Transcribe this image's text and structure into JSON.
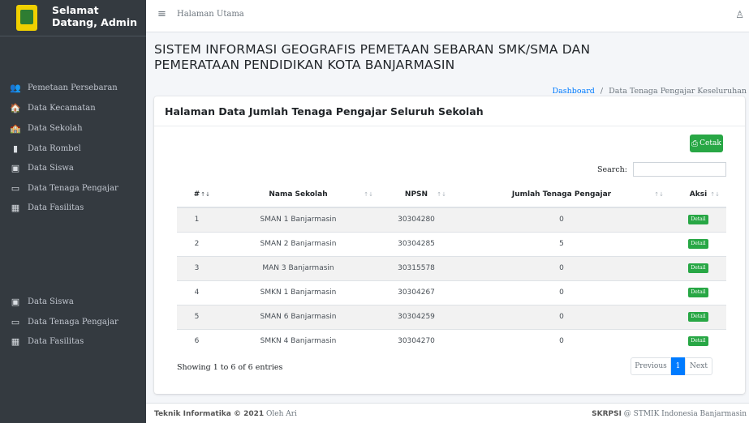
{
  "sidebar": {
    "brand_title": "Selamat Datang, Admin",
    "items": [
      {
        "label": "Pemetaan Persebaran",
        "icon": "users-icon",
        "glyph": "👥"
      },
      {
        "label": "Data Kecamatan",
        "icon": "home-icon",
        "glyph": "🏠"
      },
      {
        "label": "Data Sekolah",
        "icon": "school-icon",
        "glyph": "🏫"
      },
      {
        "label": "Data Rombel",
        "icon": "book-icon",
        "glyph": "▮"
      },
      {
        "label": "Data Siswa",
        "icon": "id-card-icon",
        "glyph": "▣"
      },
      {
        "label": "Data Tenaga Pengajar",
        "icon": "teacher-board-icon",
        "glyph": "▭"
      },
      {
        "label": "Data Fasilitas",
        "icon": "table-icon",
        "glyph": "▦"
      }
    ],
    "items_lower": [
      {
        "label": "Data Siswa",
        "icon": "id-card-icon",
        "glyph": "▣"
      },
      {
        "label": "Data Tenaga Pengajar",
        "icon": "teacher-board-icon",
        "glyph": "▭"
      },
      {
        "label": "Data Fasilitas",
        "icon": "table-icon",
        "glyph": "▦"
      }
    ]
  },
  "topbar": {
    "menu_glyph": "≡",
    "home_label": "Halaman Utama",
    "user_glyph": "♙"
  },
  "page": {
    "title": "SISTEM INFORMASI GEOGRAFIS PEMETAAN SEBARAN SMK/SMA DAN PEMERATAAN PENDIDIKAN KOTA BANJARMASIN",
    "breadcrumb_link": "Dashboard",
    "breadcrumb_sep": "/",
    "breadcrumb_current": "Data Tenaga Pengajar Keseluruhan"
  },
  "card": {
    "title": "Halaman Data Jumlah Tenaga Pengajar Seluruh Sekolah",
    "print_glyph": "⎙",
    "print_label": "Cetak",
    "search_label": "Search:",
    "search_value": ""
  },
  "table": {
    "headers": [
      "#",
      "Nama Sekolah",
      "NPSN",
      "Jumlah Tenaga Pengajar",
      "Aksi"
    ],
    "sort_glyph": "↑↓",
    "rows": [
      {
        "no": "1",
        "nama": "SMAN 1 Banjarmasin",
        "npsn": "30304280",
        "jumlah": "0",
        "aksi": "Detail"
      },
      {
        "no": "2",
        "nama": "SMAN 2 Banjarmasin",
        "npsn": "30304285",
        "jumlah": "5",
        "aksi": "Detail"
      },
      {
        "no": "3",
        "nama": "MAN 3 Banjarmasin",
        "npsn": "30315578",
        "jumlah": "0",
        "aksi": "Detail"
      },
      {
        "no": "4",
        "nama": "SMKN 1 Banjarmasin",
        "npsn": "30304267",
        "jumlah": "0",
        "aksi": "Detail"
      },
      {
        "no": "5",
        "nama": "SMAN 6 Banjarmasin",
        "npsn": "30304259",
        "jumlah": "0",
        "aksi": "Detail"
      },
      {
        "no": "6",
        "nama": "SMKN 4 Banjarmasin",
        "npsn": "30304270",
        "jumlah": "0",
        "aksi": "Detail"
      }
    ],
    "info": "Showing 1 to 6 of 6 entries",
    "pager_prev": "Previous",
    "pager_current": "1",
    "pager_next": "Next"
  },
  "footer": {
    "left_bold": "Teknik Informatika © 2021",
    "left_rest": " Oleh Ari",
    "right_bold": "SKRPSI",
    "right_rest": " @ STMIK Indonesia Banjarmasin"
  },
  "colors": {
    "sidebar_bg": "#343a40",
    "primary": "#007bff",
    "success": "#28a745"
  }
}
